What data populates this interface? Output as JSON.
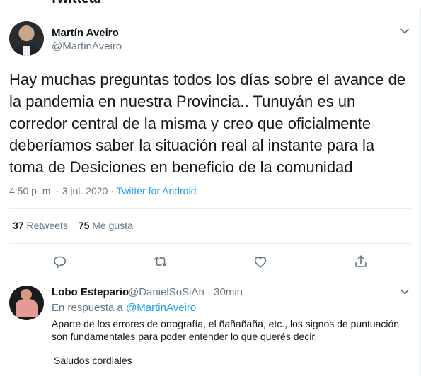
{
  "header": {
    "title": "Twittear"
  },
  "tweet": {
    "author_name": "Martín Aveiro",
    "author_handle": "@MartinAveiro",
    "text": "Hay muchas preguntas todos los días sobre el avance de la pandemia en nuestra Provincia.. Tunuyán es un corredor central de la misma y creo que oficialmente deberíamos saber la situación real al instante para la toma de Desiciones en beneficio de la comunidad",
    "time": "4:50 p. m.",
    "date": "3 jul. 2020",
    "separator": " · ",
    "source": "Twitter for Android",
    "retweets_count": "37",
    "retweets_label": "Retweets",
    "likes_count": "75",
    "likes_label": "Me gusta"
  },
  "reply": {
    "author_name": "Lobo Estepario",
    "author_handle": "@DanielSoSiAn",
    "time": "30min",
    "context_label": "En respuesta a",
    "context_mention": "@MartinAveiro",
    "text": "Aparte de los errores de ortografía, el ñañañaña, etc., los signos de puntuación son fundamentales para poder entender lo que querés decir.",
    "text2": "Saludos cordiales"
  },
  "icons": {
    "more": "chevron-down-icon",
    "reply": "reply-icon",
    "retweet": "retweet-icon",
    "like": "heart-icon",
    "share": "share-icon"
  },
  "colors": {
    "link": "#1da1f2",
    "secondary": "#657786",
    "text": "#14171a",
    "border": "#e6ecf0"
  }
}
